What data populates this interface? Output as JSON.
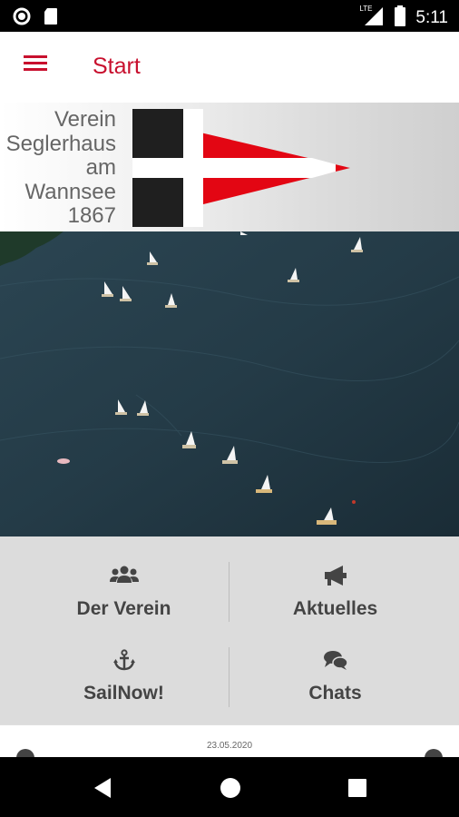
{
  "status_bar": {
    "time": "5:11",
    "network": "LTE",
    "icons": [
      "record-icon",
      "sd-card-icon",
      "lte-signal-icon",
      "battery-icon"
    ]
  },
  "app_bar": {
    "title": "Start",
    "menu_icon": "hamburger-menu-icon"
  },
  "banner": {
    "club_name_lines": [
      "Verein",
      "Seglerhaus",
      "am",
      "Wannsee",
      "1867"
    ],
    "flag_colors": {
      "dark": "#1f1f1f",
      "white": "#ffffff",
      "red": "#e30613"
    }
  },
  "hero": {
    "description_icon": "sailing-lake-photo"
  },
  "menu_tiles": [
    {
      "label": "Der Verein",
      "icon": "users-icon"
    },
    {
      "label": "Aktuelles",
      "icon": "megaphone-icon"
    },
    {
      "label": "SailNow!",
      "icon": "anchor-icon"
    },
    {
      "label": "Chats",
      "icon": "chat-bubbles-icon"
    }
  ],
  "news": {
    "date": "23.05.2020"
  },
  "nav_bar": {
    "icons": [
      "back-icon",
      "home-icon",
      "recents-icon"
    ]
  },
  "colors": {
    "accent": "#c8102e",
    "tile_bg": "#dcdcdc",
    "tile_text": "#444444"
  }
}
